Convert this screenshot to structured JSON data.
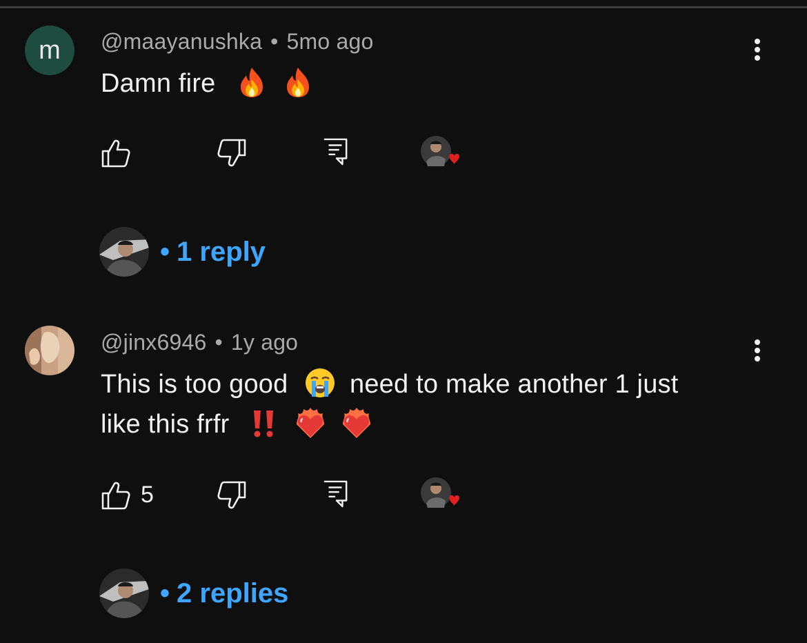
{
  "comments": [
    {
      "avatar_letter": "m",
      "avatar_color": "#1e4d3f",
      "author": "@maayanushka",
      "time": "5mo ago",
      "text_parts": [
        "Damn fire"
      ],
      "likes": "",
      "replies_label": "1 reply"
    },
    {
      "author": "@jinx6946",
      "time": "1y ago",
      "text_line1": "This is too good",
      "text_line1b": "need to make another 1 just",
      "text_line2": "like this frfr",
      "likes": "5",
      "replies_label": "2 replies"
    }
  ],
  "meta_separator": "•",
  "reply_separator": "•",
  "colors": {
    "link": "#3ea6ff",
    "background": "#0f0f0f",
    "muted": "#aaaaaa",
    "heart": "#e0201f"
  }
}
